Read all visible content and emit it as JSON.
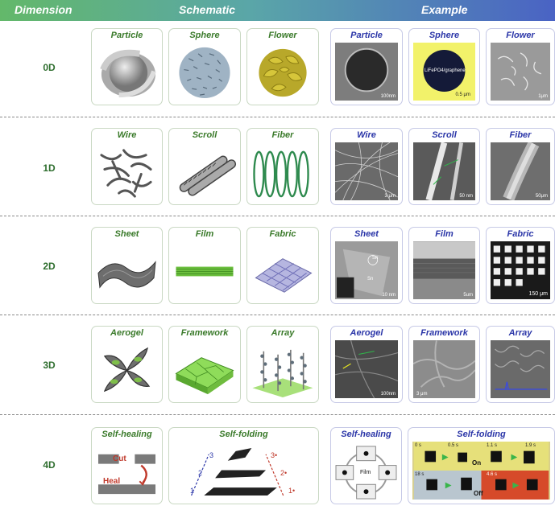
{
  "header": {
    "dimension": "Dimension",
    "schematic": "Schematic",
    "example": "Example"
  },
  "rows": {
    "r0": "0D",
    "r1": "1D",
    "r2": "2D",
    "r3": "3D",
    "r4": "4D"
  },
  "schematic": {
    "particle": "Particle",
    "sphere": "Sphere",
    "flower": "Flower",
    "wire": "Wire",
    "scroll": "Scroll",
    "fiber": "Fiber",
    "sheet": "Sheet",
    "film": "Film",
    "fabric": "Fabric",
    "aerogel": "Aerogel",
    "framework": "Framework",
    "array": "Array",
    "self_healing": "Self-healing",
    "self_folding": "Self-folding"
  },
  "example": {
    "particle": "Particle",
    "sphere": "Sphere",
    "flower": "Flower",
    "wire": "Wire",
    "scroll": "Scroll",
    "fiber": "Fiber",
    "sheet": "Sheet",
    "film": "Film",
    "fabric": "Fabric",
    "aerogel": "Aerogel",
    "framework": "Framework",
    "array": "Array",
    "self_healing": "Self-healing",
    "self_folding": "Self-folding"
  },
  "annotations": {
    "particle_scale": "100nm",
    "sphere_label": "LiFePO4/graphene",
    "sphere_scale": "0.5 μm",
    "flower_scale": "1μm",
    "wire_scale": "3 μm",
    "scroll_scale": "50 nm",
    "fiber_scale": "50μm",
    "sheet_sn1": "Sn",
    "sheet_sn2": "Sn",
    "sheet_scale": "10 nm",
    "film_scale": "5um",
    "fabric_scale": "150 μm",
    "aerogel_scale": "100nm",
    "framework_scale": "3 μm",
    "cut": "Cut",
    "heal": "Heal",
    "fold_1": "1",
    "fold_2": "2",
    "fold_3": "3",
    "fold_1r": "1•",
    "fold_2r": "2•",
    "fold_3r": "3•",
    "film_label": "Film",
    "on_label": "On",
    "off_label": "Off",
    "t_0s": "0 s",
    "t_05s": "0.5 s",
    "t_11s": "1.1 s",
    "t_19s": "1.9 s",
    "t_18s": "18 s",
    "t_46s": "4.6 s"
  }
}
